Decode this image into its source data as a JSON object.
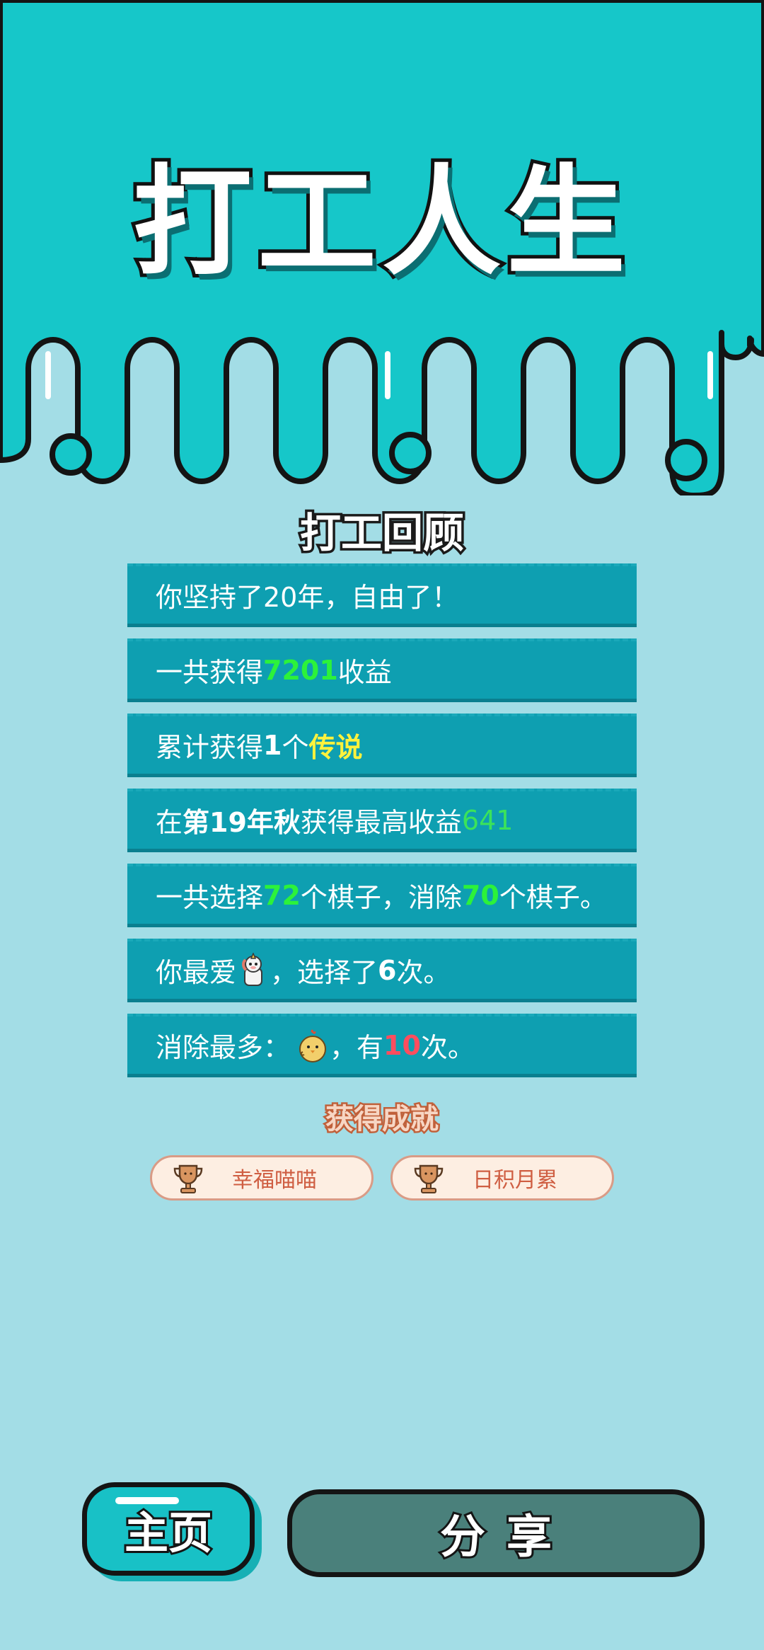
{
  "header": {
    "title": "打工人生"
  },
  "review": {
    "title": "打工回顾",
    "row1": {
      "text": "你坚持了20年，自由了！"
    },
    "row2": {
      "prefix": "一共获得",
      "value": "7201",
      "suffix": "收益"
    },
    "row3": {
      "prefix": "累计获得",
      "count": "1",
      "mid": "个",
      "rarity": "传说"
    },
    "row4": {
      "prefix": "在 ",
      "season": "第19年秋",
      "mid": " 获得最高收益",
      "value": "641"
    },
    "row5": {
      "p1": "一共选择",
      "selected": "72",
      "p2": "个棋子，消除",
      "removed": "70",
      "p3": "个棋子。"
    },
    "row6": {
      "prefix": "你最爱",
      "mid": "，选择了",
      "count": "6",
      "suffix": "次。",
      "icon": "unicorn-icon"
    },
    "row7": {
      "prefix": "消除最多：",
      "mid": "，有",
      "count": "10",
      "suffix": "次。",
      "icon": "chick-icon"
    }
  },
  "achievements": {
    "title": "获得成就",
    "items": [
      {
        "label": "幸福喵喵",
        "icon": "trophy-icon"
      },
      {
        "label": "日积月累",
        "icon": "trophy-icon"
      }
    ]
  },
  "buttons": {
    "home": "主页",
    "share": "分享"
  },
  "colors": {
    "background": "#a3dde6",
    "header": "#16c7c9",
    "row": "#0e9fb1",
    "highlight_green": "#2cf23a",
    "highlight_yellow": "#fff23c",
    "highlight_red": "#ff4d5e",
    "share_button": "#4a807b"
  }
}
